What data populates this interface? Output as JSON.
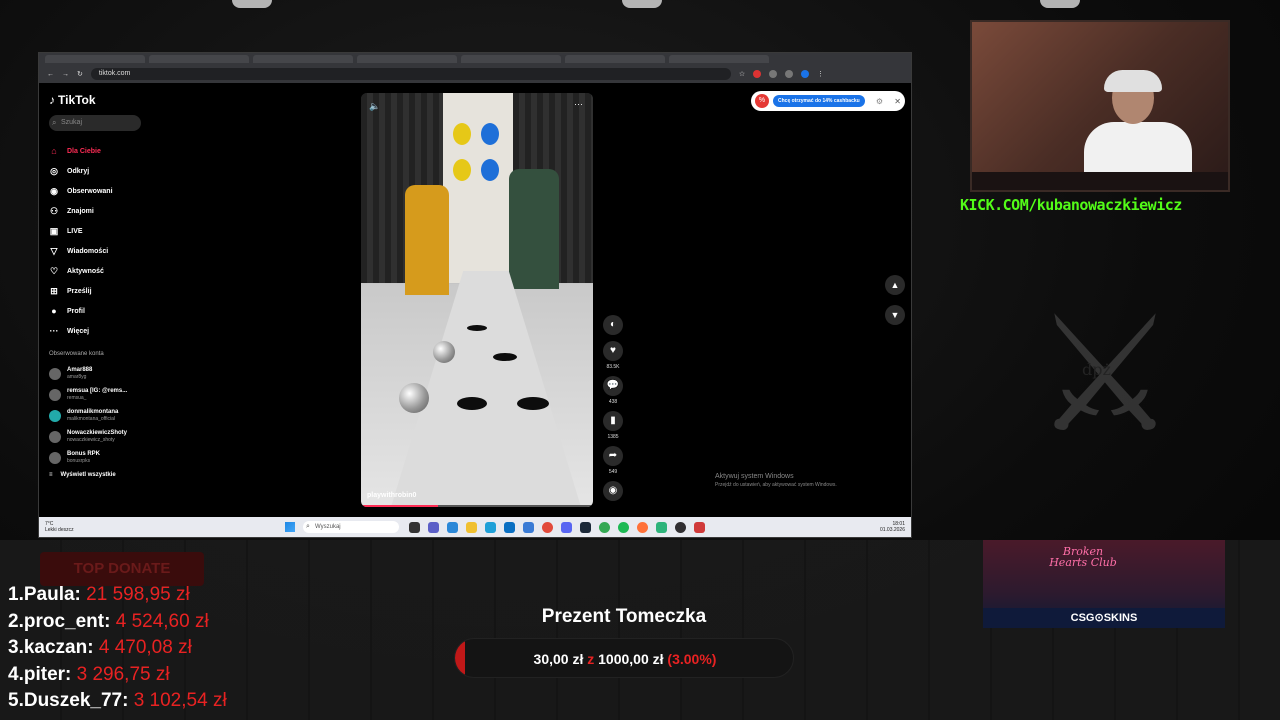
{
  "browser": {
    "url": "tiktok.com"
  },
  "sidebar": {
    "logo": "TikTok",
    "search_placeholder": "Szukaj",
    "nav": [
      {
        "label": "Dla Ciebie",
        "icon": "home-icon"
      },
      {
        "label": "Odkryj",
        "icon": "compass-icon"
      },
      {
        "label": "Obserwowani",
        "icon": "following-icon"
      },
      {
        "label": "Znajomi",
        "icon": "friends-icon"
      },
      {
        "label": "LIVE",
        "icon": "live-icon"
      },
      {
        "label": "Wiadomości",
        "icon": "messages-icon"
      },
      {
        "label": "Aktywność",
        "icon": "activity-icon"
      },
      {
        "label": "Prześlij",
        "icon": "upload-icon"
      },
      {
        "label": "Profil",
        "icon": "profile-icon"
      },
      {
        "label": "Więcej",
        "icon": "more-icon"
      }
    ],
    "following_heading": "Obserwowane konta",
    "accounts": [
      {
        "name": "Amar888",
        "handle": "amar8yg"
      },
      {
        "name": "remsua [IG: @rems...",
        "handle": "remsua_"
      },
      {
        "name": "donmalikmontana",
        "handle": "malikmontana_official"
      },
      {
        "name": "NowaczkiewiczShoty",
        "handle": "nowaczkiewicz_shoty"
      },
      {
        "name": "Bonus RPK",
        "handle": "bonusrpks"
      }
    ],
    "see_all": "Wyświetl wszystkie"
  },
  "video": {
    "author": "playwithrobin0",
    "progress_percent": 33,
    "actions": [
      {
        "icon": "like-icon",
        "count": "83.5K"
      },
      {
        "icon": "comment-icon",
        "count": "438"
      },
      {
        "icon": "bookmark-icon",
        "count": "1385"
      },
      {
        "icon": "share-icon",
        "count": "549"
      }
    ]
  },
  "cashback": {
    "button": "Chcę otrzymać do 14% cashbacku"
  },
  "windows_activation": {
    "line1": "Aktywuj system Windows",
    "line2": "Przejdź do ustawień, aby aktywować system Windows."
  },
  "taskbar": {
    "weather_temp": "7°C",
    "weather_desc": "Lekki deszcz",
    "search_placeholder": "Wyszukaj",
    "time": "18:01",
    "date": "01.03.2026"
  },
  "stream": {
    "channel_url": "KICK.COM/kubanowaczkiewicz",
    "emblem_text": "dpż",
    "ad_title": "Broken Hearts Club",
    "ad_brand": "CSG⊙SKINS",
    "top_donate_label": "TOP DONATE",
    "donors": [
      {
        "rank": "1.",
        "name": "Paula:",
        "amount": "21 598,95 zł"
      },
      {
        "rank": "2.",
        "name": "proc_ent:",
        "amount": "4 524,60 zł"
      },
      {
        "rank": "3.",
        "name": "kaczan:",
        "amount": "4 470,08 zł"
      },
      {
        "rank": "4.",
        "name": "piter:",
        "amount": "3 296,75 zł"
      },
      {
        "rank": "5.",
        "name": "Duszek_77:",
        "amount": "3 102,54 zł"
      }
    ],
    "gift": {
      "title": "Prezent Tomeczka",
      "current": "30,00 zł",
      "separator": "z",
      "goal": "1000,00 zł",
      "percent_text": "(3.00%)",
      "percent_value": 3
    }
  },
  "colors": {
    "tiktok_red": "#fe2c55",
    "kick_green": "#53fc18",
    "donate_red": "#e82222"
  }
}
